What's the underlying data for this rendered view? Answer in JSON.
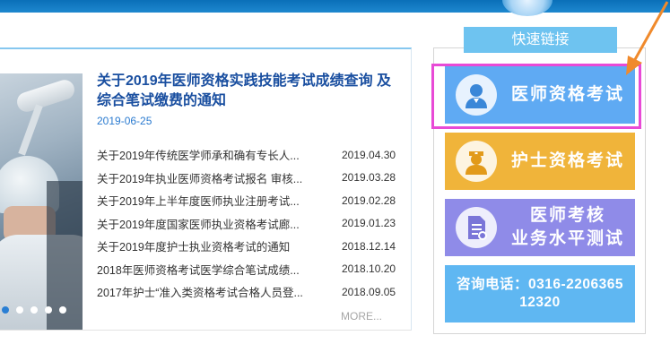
{
  "colors": {
    "header_blue": "#0a6fb8",
    "headline_blue": "#1a4fa0",
    "quick_title_bg": "#6ec3f0",
    "doctor_exam_bg": "#5faaf3",
    "nurse_exam_bg": "#f0b43a",
    "skill_test_bg": "#8f8be8",
    "contact_bg": "#5fb7f2",
    "highlight_border": "#e84ad6",
    "arrow": "#f08a2c"
  },
  "news": {
    "headline": "关于2019年医师资格实践技能考试成绩查询 及综合笔试缴费的通知",
    "headline_date": "2019-06-25",
    "items": [
      {
        "title": "关于2019年传统医学师承和确有专长人...",
        "date": "2019.04.30"
      },
      {
        "title": "关于2019年执业医师资格考试报名 审核...",
        "date": "2019.03.28"
      },
      {
        "title": "关于2019年上半年度医师执业注册考试...",
        "date": "2019.02.28"
      },
      {
        "title": "关于2019年度国家医师执业资格考试廊...",
        "date": "2019.01.23"
      },
      {
        "title": "关于2019年度护士执业资格考试的通知",
        "date": "2018.12.14"
      },
      {
        "title": "2018年医师资格考试医学综合笔试成绩...",
        "date": "2018.10.20"
      },
      {
        "title": "2017年护士“准入类资格考试合格人员登...",
        "date": "2018.09.05"
      }
    ],
    "more_label": "MORE...",
    "slide_dots": 5,
    "active_dot": 0
  },
  "quick_links": {
    "title": "快速链接",
    "doctor_exam": {
      "label": "医师资格考试",
      "icon": "doctor-icon"
    },
    "nurse_exam": {
      "label": "护士资格考试",
      "icon": "nurse-icon"
    },
    "skill_test": {
      "label_line1": "医师考核",
      "label_line2": "业务水平测试",
      "icon": "document-icon"
    },
    "contact": {
      "line1": "咨询电话：0316-2206365",
      "line2": "12320"
    }
  }
}
